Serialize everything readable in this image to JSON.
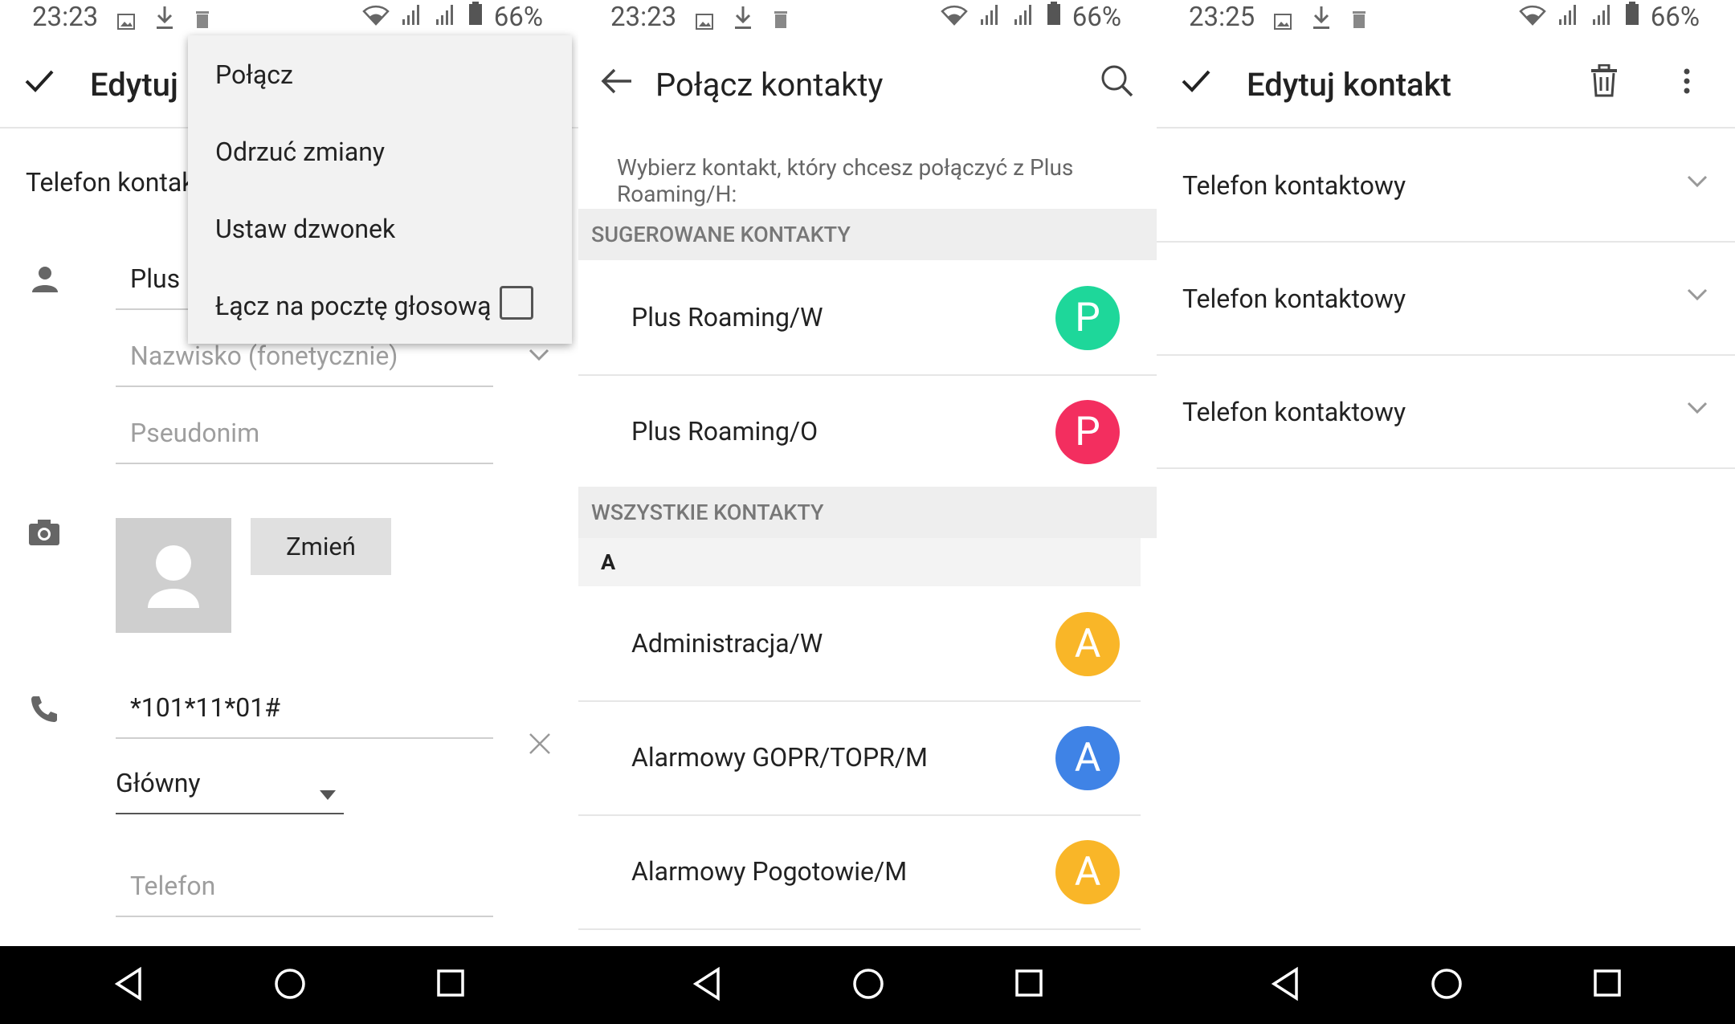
{
  "status_bars": [
    {
      "time": "23:23",
      "battery": "66%"
    },
    {
      "time": "23:23",
      "battery": "66%"
    },
    {
      "time": "23:25",
      "battery": "66%"
    }
  ],
  "panel1": {
    "toolbar_title": "Edytuj",
    "section_label": "Telefon kontak",
    "name_value": "Plus I",
    "phonetic_placeholder": "Nazwisko (fonetycznie)",
    "nickname_placeholder": "Pseudonim",
    "change_photo_label": "Zmień",
    "phone_value": "*101*11*01#",
    "phone_type": "Główny",
    "phone_placeholder": "Telefon",
    "menu": {
      "items": [
        "Połącz",
        "Odrzuć zmiany",
        "Ustaw dzwonek",
        "Łącz na pocztę głosową"
      ],
      "voicemail_checked": false
    }
  },
  "panel2": {
    "toolbar_title": "Połącz kontakty",
    "subtitle": "Wybierz kontakt, który chcesz połączyć z Plus Roaming/H:",
    "suggested_header": "SUGEROWANE KONTAKTY",
    "suggested": [
      {
        "name": "Plus Roaming/W",
        "initial": "P",
        "color": "#1ed79a"
      },
      {
        "name": "Plus Roaming/O",
        "initial": "P",
        "color": "#f32e5f"
      }
    ],
    "all_header": "WSZYSTKIE KONTAKTY",
    "letter": "A",
    "all": [
      {
        "name": "Administracja/W",
        "initial": "A",
        "color": "#f9b628"
      },
      {
        "name": "Alarmowy GOPR/TOPR/M",
        "initial": "A",
        "color": "#3f83e6"
      },
      {
        "name": "Alarmowy Pogotowie/M",
        "initial": "A",
        "color": "#f9b628"
      }
    ]
  },
  "panel3": {
    "toolbar_title": "Edytuj kontakt",
    "rows": [
      "Telefon kontaktowy",
      "Telefon kontaktowy",
      "Telefon kontaktowy"
    ]
  }
}
